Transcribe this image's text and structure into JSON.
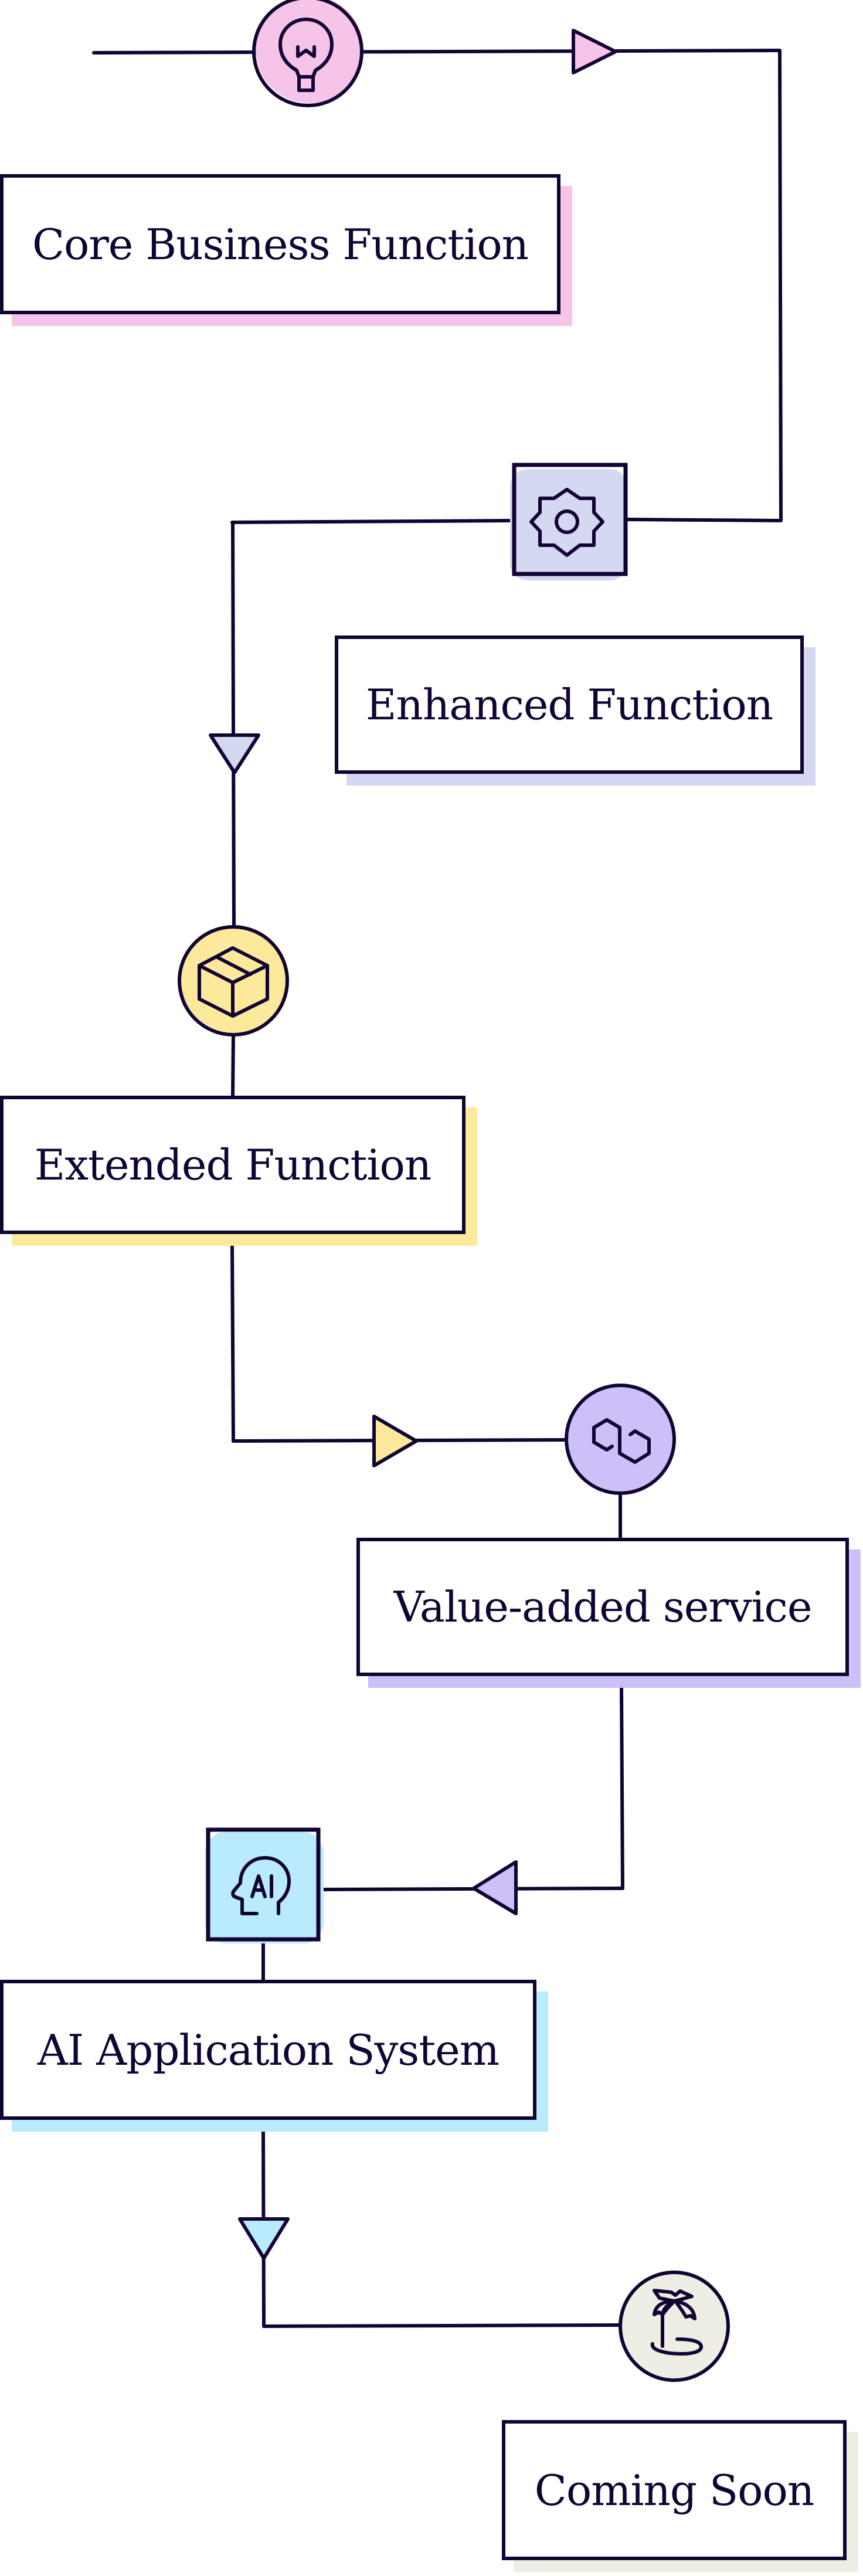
{
  "diagram": {
    "type": "flowchart",
    "stroke_color": "#110433",
    "steps": [
      {
        "id": "core",
        "label": "Core Business Function",
        "icon": "lightbulb-icon",
        "icon_shape": "circle",
        "color": "#F6C4E9"
      },
      {
        "id": "enhanced",
        "label": "Enhanced Function",
        "icon": "gear-icon",
        "icon_shape": "square",
        "color": "#D4D8F0"
      },
      {
        "id": "extended",
        "label": "Extended Function",
        "icon": "package-icon",
        "icon_shape": "circle",
        "color": "#FCE99B"
      },
      {
        "id": "value",
        "label": "Value-added service",
        "icon": "polygon-link-icon",
        "icon_shape": "circle",
        "color": "#CDC0F8"
      },
      {
        "id": "ai",
        "label": "AI Application System",
        "icon": "ai-head-icon",
        "icon_shape": "square",
        "color": "#BAEBFC"
      },
      {
        "id": "soon",
        "label": "Coming Soon",
        "icon": "palm-tree-icon",
        "icon_shape": "circle",
        "color": "#EFEEE4"
      }
    ],
    "arrows": [
      {
        "from": "core",
        "to": "enhanced",
        "direction": "right",
        "color": "#F6C4E9"
      },
      {
        "from": "enhanced",
        "to": "extended",
        "direction": "down",
        "color": "#D4D8F0"
      },
      {
        "from": "extended",
        "to": "value",
        "direction": "right",
        "color": "#FCE99B"
      },
      {
        "from": "value",
        "to": "ai",
        "direction": "left",
        "color": "#CDC0F8"
      },
      {
        "from": "ai",
        "to": "soon",
        "direction": "down",
        "color": "#BAEBFC"
      }
    ]
  }
}
